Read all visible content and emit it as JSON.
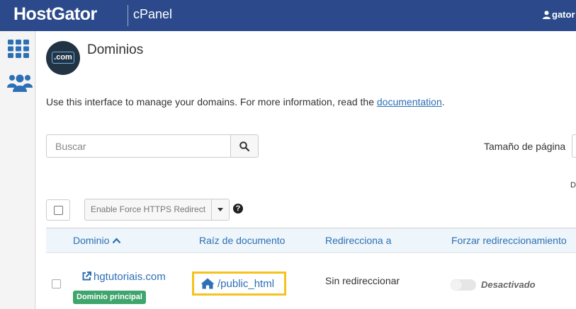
{
  "topbar": {
    "brand": "HostGator",
    "product": "cPanel",
    "user": "gator"
  },
  "sidebar": {
    "items": [
      {
        "icon": "grid-icon"
      },
      {
        "icon": "users-icon"
      }
    ]
  },
  "page": {
    "logo_text": ".com",
    "title": "Dominios",
    "description": "Use this interface to manage your domains. For more information, read the ",
    "description_link": "documentation",
    "description_end": "."
  },
  "search": {
    "placeholder": "Buscar"
  },
  "pagesize": {
    "label": "Tamaño de página"
  },
  "trunc_label": "D",
  "toolbar": {
    "https_button": "Enable Force HTTPS Redirect",
    "help": "?"
  },
  "table": {
    "headers": [
      "Dominio",
      "Raíz de documento",
      "Redirecciona a",
      "Forzar redireccionamiento"
    ],
    "rows": [
      {
        "domain": "hgtutoriais.com",
        "badge": "Dominio principal",
        "docroot": "/public_html",
        "redirect": "Sin redireccionar",
        "force_https": "Desactivado"
      }
    ]
  },
  "colors": {
    "topbar": "#2c4a8b",
    "link": "#2c6fb4",
    "badge": "#3fa56c",
    "highlight": "#f6c21c"
  }
}
